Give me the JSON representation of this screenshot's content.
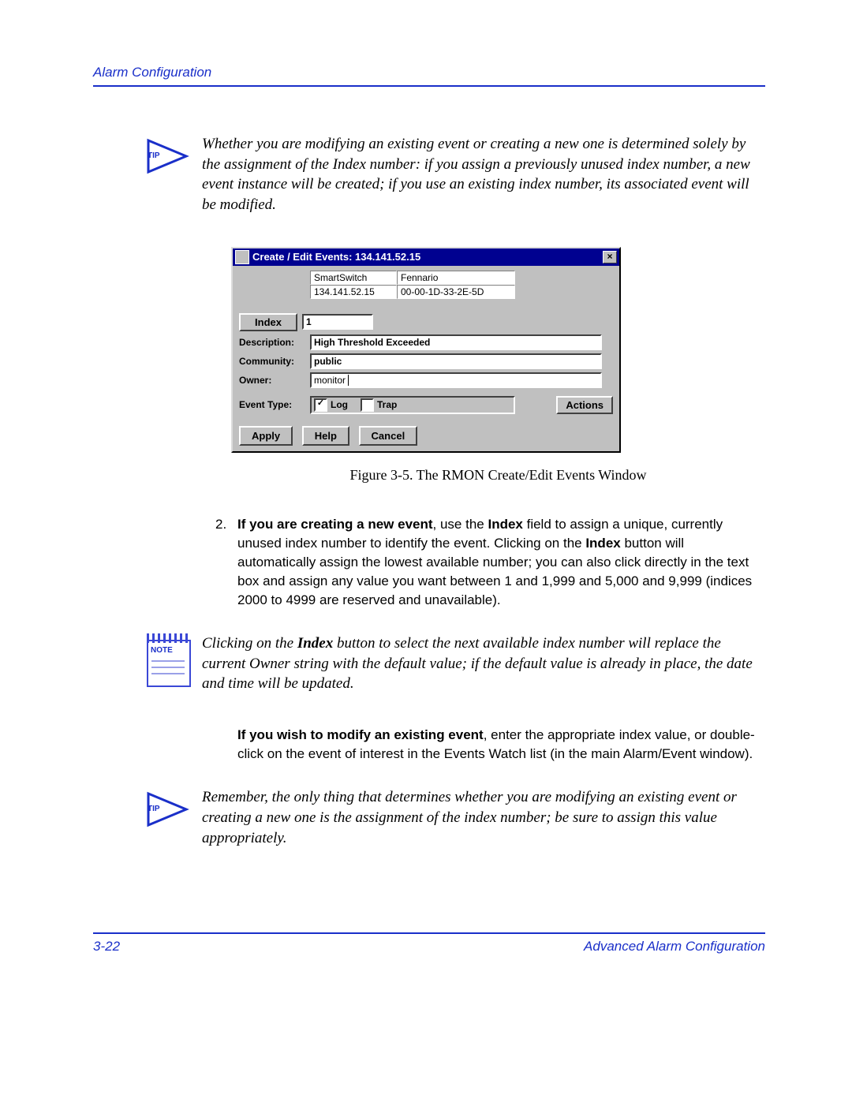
{
  "header": {
    "section": "Alarm Configuration"
  },
  "tip1": {
    "label": "TIP",
    "text": "Whether you are modifying an existing event or creating a new one is determined solely by the assignment of the Index number: if you assign a previously unused index number, a new event instance will be created; if you use an existing index number, its associated event will be modified."
  },
  "dialog": {
    "title": "Create / Edit Events: 134.141.52.15",
    "close": "×",
    "cell_a1": "SmartSwitch",
    "cell_a2": "Fennario",
    "cell_b1": "134.141.52.15",
    "cell_b2": "00-00-1D-33-2E-5D",
    "index_btn": "Index",
    "index_val": "1",
    "lbl_desc": "Description:",
    "val_desc": "High Threshold Exceeded",
    "lbl_comm": "Community:",
    "val_comm": "public",
    "lbl_owner": "Owner:",
    "val_owner": "monitor",
    "lbl_etype": "Event Type:",
    "chk_log": "Log",
    "chk_trap": "Trap",
    "btn_actions": "Actions",
    "btn_apply": "Apply",
    "btn_help": "Help",
    "btn_cancel": "Cancel"
  },
  "figcaption": "Figure 3-5. The RMON Create/Edit Events Window",
  "step2": {
    "num": "2.",
    "bold1": "If you are creating a new event",
    "mid1": ", use the ",
    "bold2": "Index",
    "mid2": " field to assign a unique, currently unused index number to identify the event. Clicking on the ",
    "bold3": "Index",
    "tail": " button will automatically assign the lowest available number; you can also click directly in the text box and assign any value you want between 1 and 1,999 and 5,000 and 9,999 (indices 2000 to 4999 are reserved and unavailable)."
  },
  "note": {
    "label": "NOTE",
    "pre": "Clicking on the ",
    "bold": "Index",
    "post": " button to select the next available index number will replace the current Owner string with the default value; if the default value is already in place, the date and time will be updated."
  },
  "modifyPara": {
    "bold": "If you wish to modify an existing event",
    "rest": ", enter the appropriate index value, or double-click on the event of interest in the Events Watch list (in the main Alarm/Event window)."
  },
  "tip2": {
    "label": "TIP",
    "text": "Remember, the only thing that determines whether you are modifying an existing event or creating a new one is the assignment of the index number; be sure to assign this value appropriately."
  },
  "footer": {
    "page": "3-22",
    "title": "Advanced Alarm Configuration"
  }
}
